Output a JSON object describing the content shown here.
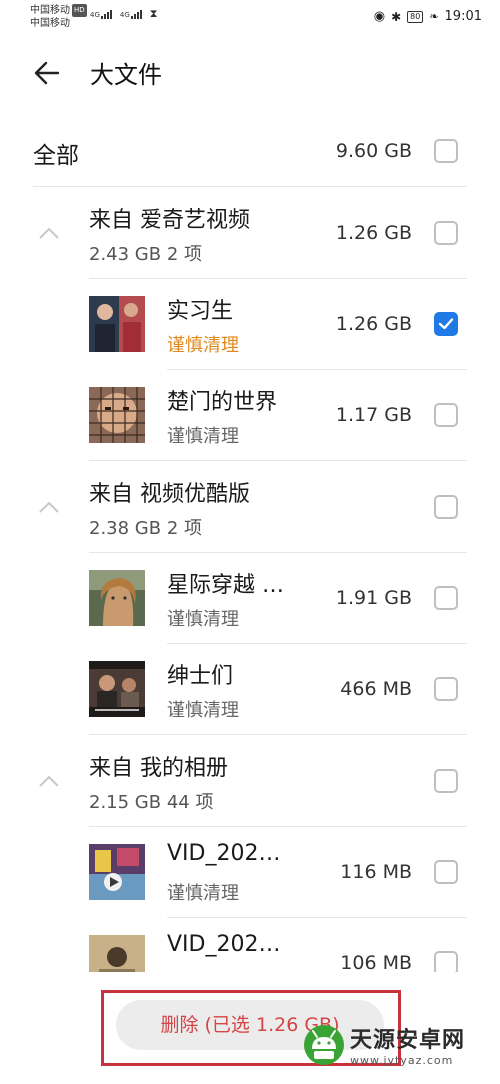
{
  "status_bar": {
    "carrier1": "中国移动",
    "hd_badge": "HD",
    "carrier2": "中国移动",
    "net1": "4G",
    "net2": "4G",
    "battery": "80",
    "time": "19:01"
  },
  "header": {
    "title": "大文件"
  },
  "all_row": {
    "label": "全部",
    "size": "9.60 GB",
    "checked": false
  },
  "groups": [
    {
      "name": "来自 爱奇艺视频",
      "summary": "2.43 GB  2 项",
      "size": "1.26 GB",
      "items": [
        {
          "name": "实习生",
          "tag": "谨慎清理",
          "size": "1.26 GB",
          "checked": true
        },
        {
          "name": "楚门的世界",
          "tag": "谨慎清理",
          "size": "1.17 GB",
          "checked": false
        }
      ]
    },
    {
      "name": "来自 视频优酷版",
      "summary": "2.38 GB  2 项",
      "size": "",
      "items": [
        {
          "name": "星际穿越 …",
          "tag": "谨慎清理",
          "size": "1.91 GB",
          "checked": false
        },
        {
          "name": "绅士们",
          "tag": "谨慎清理",
          "size": "466 MB",
          "checked": false
        }
      ]
    },
    {
      "name": "来自 我的相册",
      "summary": "2.15 GB  44 项",
      "size": "",
      "items": [
        {
          "name": "VID_202…",
          "tag": "谨慎清理",
          "size": "116 MB",
          "checked": false
        },
        {
          "name": "VID_202…",
          "tag": "",
          "size": "106 MB",
          "checked": false
        }
      ]
    }
  ],
  "bottom": {
    "delete_label": "删除 (已选 1.26 GB)"
  },
  "watermark": {
    "name": "天源安卓网",
    "url": "www.jytyaz.com"
  },
  "colors": {
    "accent": "#1f7ae5",
    "warning": "#e08a1e",
    "delete": "#d64545",
    "highlight_frame": "#c8323b"
  }
}
